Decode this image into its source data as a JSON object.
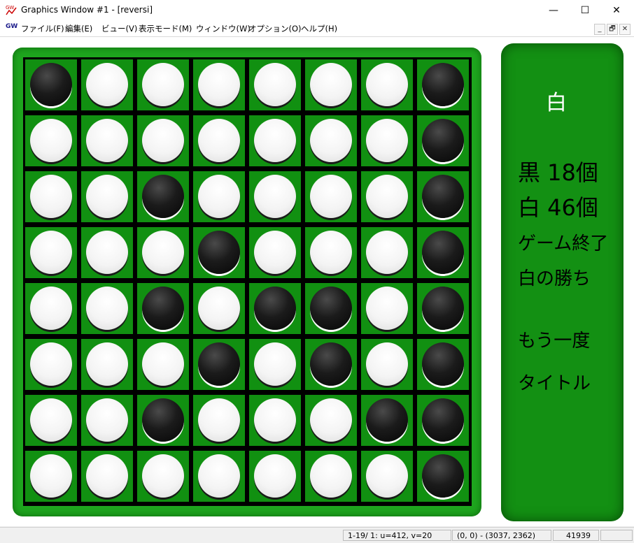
{
  "window": {
    "title": "Graphics Window #1 - [reversi]",
    "icon": "gw-app-icon",
    "controls": {
      "minimize": "—",
      "maximize": "☐",
      "close": "✕"
    }
  },
  "menubar": {
    "icon_label": "GW",
    "items": [
      "ファイル(F)",
      "編集(E)",
      "ビュー(V)",
      "表示モード(M)",
      "ウィンドウ(W)",
      "オプション(O)",
      "ヘルプ(H)"
    ],
    "mdi_controls": {
      "minimize": "_",
      "restore": "🗗",
      "close": "✕"
    }
  },
  "board": {
    "colors": {
      "board": "#119011",
      "frame": "#1ea51e",
      "grid": "#000000"
    },
    "rows": [
      [
        "B",
        "W",
        "W",
        "W",
        "W",
        "W",
        "W",
        "B"
      ],
      [
        "W",
        "W",
        "W",
        "W",
        "W",
        "W",
        "W",
        "B"
      ],
      [
        "W",
        "W",
        "B",
        "W",
        "W",
        "W",
        "W",
        "B"
      ],
      [
        "W",
        "W",
        "W",
        "B",
        "W",
        "W",
        "W",
        "B"
      ],
      [
        "W",
        "W",
        "B",
        "W",
        "B",
        "B",
        "W",
        "B"
      ],
      [
        "W",
        "W",
        "W",
        "B",
        "W",
        "B",
        "W",
        "B"
      ],
      [
        "W",
        "W",
        "B",
        "W",
        "W",
        "W",
        "B",
        "B"
      ],
      [
        "W",
        "W",
        "W",
        "W",
        "W",
        "W",
        "W",
        "B"
      ]
    ]
  },
  "panel": {
    "turn": "白",
    "black_count": "黒 18個",
    "white_count": "白 46個",
    "game_over": "ゲーム終了",
    "result": "白の勝ち",
    "retry": "もう一度",
    "title_button": "タイトル"
  },
  "statusbar": {
    "position": "1-19/ 1: u=412, v=20",
    "range": "(0, 0) - (3037, 2362)",
    "count": "41939",
    "extra": ""
  }
}
